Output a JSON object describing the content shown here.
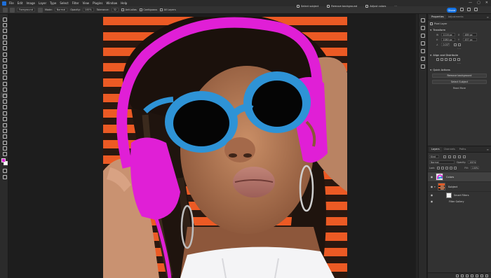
{
  "menu": {
    "items": [
      "File",
      "Edit",
      "Image",
      "Layer",
      "Type",
      "Select",
      "Filter",
      "View",
      "Plugins",
      "Window",
      "Help"
    ],
    "window_controls": [
      "—",
      "▢",
      "✕"
    ]
  },
  "options_bar": {
    "brush_preset": "Foreground",
    "mode_label": "Mode:",
    "mode_value": "Normal",
    "opacity_label": "Opacity:",
    "opacity_value": "100%",
    "tolerance_label": "Tolerance:",
    "tolerance_value": "32",
    "anti_alias": "Anti-alias",
    "contiguous": "Contiguous",
    "all_layers": "All Layers"
  },
  "contextual": {
    "select_subject": "Select subject",
    "remove_background": "Remove background",
    "adjust_colors": "Adjust colors"
  },
  "share_label": "Share",
  "properties": {
    "tabs": [
      "Properties",
      "Adjustments"
    ],
    "layer_type": "Pixel Layer",
    "transform": {
      "title": "Transform",
      "w": "1116 px",
      "x": "489 px",
      "h": "1080 px",
      "y": "457 px",
      "angle": "0.00°"
    },
    "align_title": "Align and Distribute",
    "quick_actions_title": "Quick Actions",
    "remove_bg_button": "Remove background",
    "select_subject_button": "Select Subject",
    "read_more": "Read More"
  },
  "layers": {
    "tabs": [
      "Layers",
      "Channels",
      "Paths"
    ],
    "filter_kind": "Kind",
    "blend_mode": "Normal",
    "opacity_label": "Opacity:",
    "opacity_value": "100%",
    "lock_label": "Lock:",
    "fill_label": "Fill:",
    "fill_value": "100%",
    "items": {
      "colors": "Colors",
      "subject": "Subject",
      "smart_filters": "Smart Filters",
      "filter_gallery": "Filter Gallery"
    }
  },
  "colors": {
    "headphones": "#e01fd6",
    "sunglasses": "#2e93d6",
    "accent": "#1473e6",
    "foreground_swatch": "#e01fd6",
    "background_swatch": "#ffffff"
  }
}
